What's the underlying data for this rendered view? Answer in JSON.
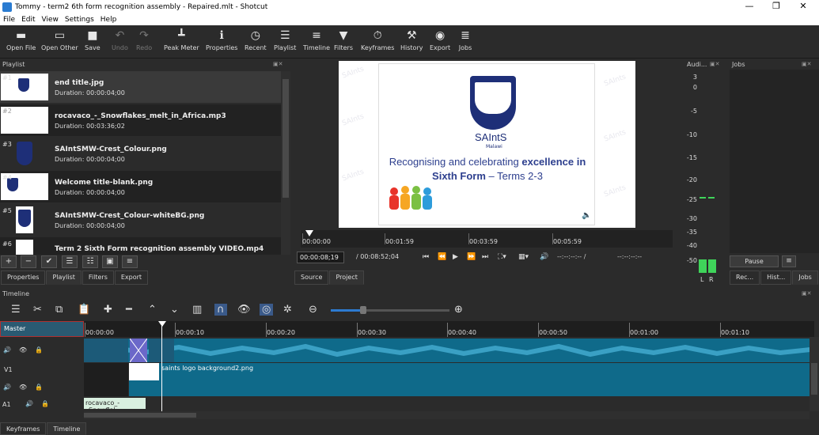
{
  "window": {
    "title": "Tommy - term2 6th form recognition assembly - Repaired.mlt - Shotcut"
  },
  "menu": [
    "File",
    "Edit",
    "View",
    "Settings",
    "Help"
  ],
  "toolbar": [
    {
      "label": "Open File",
      "icon": "open-file-icon"
    },
    {
      "label": "Open Other",
      "icon": "open-other-icon"
    },
    {
      "label": "Save",
      "icon": "save-icon"
    },
    {
      "label": "Undo",
      "icon": "undo-icon"
    },
    {
      "label": "Redo",
      "icon": "redo-icon"
    },
    {
      "label": "Peak Meter",
      "icon": "peak-meter-icon"
    },
    {
      "label": "Properties",
      "icon": "properties-icon"
    },
    {
      "label": "Recent",
      "icon": "recent-icon"
    },
    {
      "label": "Playlist",
      "icon": "playlist-icon"
    },
    {
      "label": "Timeline",
      "icon": "timeline-icon"
    },
    {
      "label": "Filters",
      "icon": "filters-icon"
    },
    {
      "label": "Keyframes",
      "icon": "keyframes-icon"
    },
    {
      "label": "History",
      "icon": "history-icon"
    },
    {
      "label": "Export",
      "icon": "export-icon"
    },
    {
      "label": "Jobs",
      "icon": "jobs-icon"
    }
  ],
  "playlist": {
    "title": "Playlist",
    "items": [
      {
        "num": "#1",
        "name": "end title.jpg",
        "duration": "Duration: 00:00:04;00"
      },
      {
        "num": "#2",
        "name": "rocavaco_-_Snowflakes_melt_in_Africa.mp3",
        "duration": "Duration: 00:03:36;02"
      },
      {
        "num": "#3",
        "name": "SAIntSMW-Crest_Colour.png",
        "duration": "Duration: 00:00:04;00"
      },
      {
        "num": "#4",
        "name": "Welcome title-blank.png",
        "duration": "Duration: 00:00:04;00"
      },
      {
        "num": "#5",
        "name": "SAIntSMW-Crest_Colour-whiteBG.png",
        "duration": "Duration: 00:00:04;00"
      },
      {
        "num": "#6",
        "name": "Term 2 Sixth Form recognition assembly VIDEO.mp4",
        "duration": ""
      }
    ],
    "tabs": [
      "Properties",
      "Playlist",
      "Filters",
      "Export"
    ]
  },
  "viewer": {
    "slide_brand": "SAIntS",
    "slide_sub": "Malawi",
    "slide_headline_1": "Recognising and celebrating ",
    "slide_headline_bold": "excellence in Sixth Form",
    "slide_headline_2": " – Terms 2-3",
    "watermark": "SAInts",
    "ruler_labels": [
      "00:00:00",
      "00:01:59",
      "00:03:59",
      "00:05:59"
    ],
    "current_time": "00:00:08;19",
    "total_time": "/ 00:08:52;04",
    "in_point": "--:--:--:--  /",
    "out_point": "--:--:--:--",
    "tabs": [
      "Source",
      "Project"
    ]
  },
  "audio": {
    "title": "Audi...",
    "scale": [
      "3",
      "0",
      "-5",
      "-10",
      "-15",
      "-20",
      "-25",
      "-30",
      "-35",
      "-40",
      "-50"
    ],
    "channels": [
      "L",
      "R"
    ]
  },
  "jobs": {
    "title": "Jobs",
    "pause_label": "Pause",
    "tabs": [
      "Rec...",
      "Hist...",
      "Jobs"
    ]
  },
  "timeline": {
    "title": "Timeline",
    "master": "Master",
    "tracks": [
      "V1",
      "A1"
    ],
    "ruler_labels": [
      "00:00:00",
      "00:00:10",
      "00:00:20",
      "00:00:30",
      "00:00:40",
      "00:00:50",
      "00:01:00",
      "00:01:10"
    ],
    "clip_video": "saints logo background2.png",
    "clip_audio": "rocavaco_-_Snowflal"
  },
  "bottom_tabs": [
    "Keyframes",
    "Timeline"
  ]
}
